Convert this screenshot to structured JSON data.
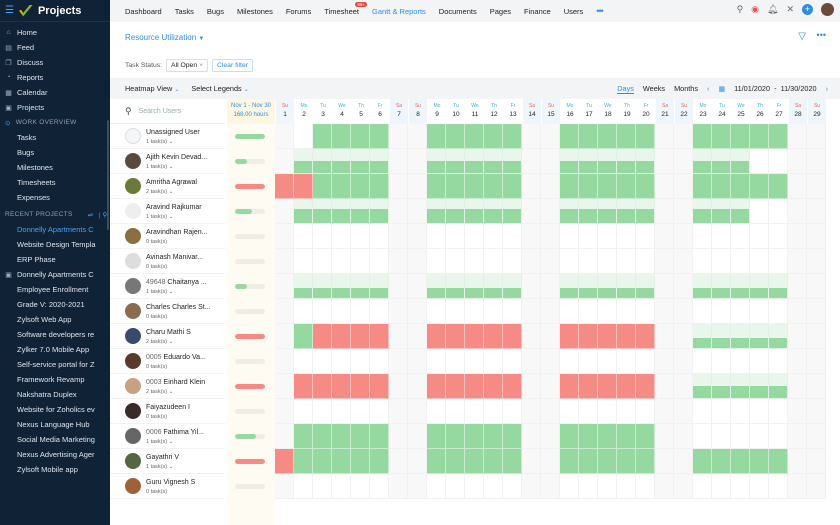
{
  "sidebar": {
    "title": "Projects",
    "items": [
      {
        "label": "Home",
        "icon": "home-icon",
        "glyph": "⌂"
      },
      {
        "label": "Feed",
        "icon": "feed-icon",
        "glyph": "▤"
      },
      {
        "label": "Discuss",
        "icon": "discuss-icon",
        "glyph": "❐"
      },
      {
        "label": "Reports",
        "icon": "reports-icon",
        "glyph": "◔"
      },
      {
        "label": "Calendar",
        "icon": "calendar-icon",
        "glyph": "▦"
      },
      {
        "label": "Projects",
        "icon": "projects-icon",
        "glyph": "▣"
      }
    ],
    "work_overview": {
      "label": "WORK OVERVIEW",
      "items": [
        "Tasks",
        "Bugs",
        "Milestones",
        "Timesheets",
        "Expenses"
      ]
    },
    "recent": {
      "label": "RECENT PROJECTS",
      "items": [
        "Donnelly Apartments C",
        "Website Design Templa",
        "ERP Phase",
        "Donnelly Apartments C",
        "Employee Enrollment",
        "Grade V: 2020-2021",
        "Zylsoft Web App",
        "Software developers re",
        "Zylker 7.0 Mobile App",
        "Self-service portal for Z",
        "Framework Revamp",
        "Nakshatra Duplex",
        "Website for Zoholics ev",
        "Nexus Language Hub",
        "Social Media Marketing",
        "Nexus Advertising Ager",
        "Zylsoft Mobile app"
      ]
    }
  },
  "nav": {
    "items": [
      "Dashboard",
      "Tasks",
      "Bugs",
      "Milestones",
      "Forums",
      "Timesheet",
      "Gantt & Reports",
      "Documents",
      "Pages",
      "Finance",
      "Users"
    ],
    "active": "Gantt & Reports",
    "badge": "99+",
    "more": "•••"
  },
  "header": {
    "report": "Resource Utilization",
    "task_status_label": "Task Status:",
    "task_status_value": "All Open",
    "clear_filter": "Clear filter"
  },
  "toolbar": {
    "view": "Heatmap View",
    "legends": "Select Legends",
    "tabs": [
      "Days",
      "Weeks",
      "Months"
    ],
    "active_tab": "Days",
    "date_range": "11/01/2020  -  11/30/2020"
  },
  "colors": {
    "accent": "#2d8ee6",
    "allocated": "#96d9a0",
    "over": "#f68a85",
    "under_bg": "#e8f6ec"
  },
  "grid": {
    "search_placeholder": "Search Users",
    "period": "Nov 1 - Nov 30",
    "hours": "168.00 hours",
    "days": [
      [
        "Su",
        1
      ],
      [
        "Mo",
        2
      ],
      [
        "Tu",
        3
      ],
      [
        "We",
        4
      ],
      [
        "Th",
        5
      ],
      [
        "Fr",
        6
      ],
      [
        "Sa",
        7
      ],
      [
        "Su",
        8
      ],
      [
        "Mo",
        9
      ],
      [
        "Tu",
        10
      ],
      [
        "We",
        11
      ],
      [
        "Th",
        12
      ],
      [
        "Fr",
        13
      ],
      [
        "Sa",
        14
      ],
      [
        "Su",
        15
      ],
      [
        "Mo",
        16
      ],
      [
        "Tu",
        17
      ],
      [
        "We",
        18
      ],
      [
        "Th",
        19
      ],
      [
        "Fr",
        20
      ],
      [
        "Sa",
        21
      ],
      [
        "Su",
        22
      ],
      [
        "Mo",
        23
      ],
      [
        "Tu",
        24
      ],
      [
        "We",
        25
      ],
      [
        "Th",
        26
      ],
      [
        "Fr",
        27
      ],
      [
        "Sa",
        28
      ],
      [
        "Su",
        29
      ]
    ]
  },
  "users": [
    {
      "id": "",
      "name": "Unassigned User",
      "tasks": "1 task(s)",
      "util": 1,
      "status": "ok",
      "alloc": [
        [
          3,
          6,
          "full"
        ],
        [
          9,
          13,
          "full"
        ],
        [
          16,
          20,
          "full"
        ],
        [
          23,
          27,
          "full"
        ]
      ]
    },
    {
      "id": "",
      "name": "Ajith Kevin Devad...",
      "tasks": "1 task(s)",
      "util": 0.4,
      "status": "ok",
      "alloc": [
        [
          2,
          6,
          0.5
        ],
        [
          9,
          13,
          0.5
        ],
        [
          16,
          20,
          0.5
        ],
        [
          23,
          25,
          0.5
        ]
      ]
    },
    {
      "id": "",
      "name": "Amritha Agrawal",
      "tasks": "2 task(s)",
      "util": 1,
      "status": "over",
      "alloc": [
        [
          1,
          2,
          "over"
        ],
        [
          3,
          6,
          "full"
        ],
        [
          9,
          13,
          "full"
        ],
        [
          16,
          20,
          "full"
        ],
        [
          23,
          27,
          "full"
        ]
      ]
    },
    {
      "id": "",
      "name": "Aravind Rajkumar",
      "tasks": "1 task(s)",
      "util": 0.55,
      "status": "ok",
      "alloc": [
        [
          2,
          6,
          0.6
        ],
        [
          9,
          13,
          0.6
        ],
        [
          16,
          20,
          0.6
        ],
        [
          23,
          25,
          0.6
        ]
      ]
    },
    {
      "id": "",
      "name": "Aravindhan Rajen...",
      "tasks": "0 task(s)",
      "util": 0,
      "status": "ok",
      "alloc": []
    },
    {
      "id": "",
      "name": "Avinash Manivar...",
      "tasks": "0 task(s)",
      "util": 0,
      "status": "ok",
      "alloc": []
    },
    {
      "id": "49648",
      "name": "Chaitanya ...",
      "tasks": "1 task(s)",
      "util": 0.4,
      "status": "ok",
      "alloc": [
        [
          2,
          6,
          0.4
        ],
        [
          9,
          13,
          0.4
        ],
        [
          16,
          20,
          0.4
        ],
        [
          23,
          27,
          0.4
        ]
      ]
    },
    {
      "id": "",
      "name": "Charles Charles St...",
      "tasks": "0 task(s)",
      "util": 0,
      "status": "ok",
      "alloc": []
    },
    {
      "id": "",
      "name": "Charu Mathi S",
      "tasks": "2 task(s)",
      "util": 1,
      "status": "over",
      "alloc": [
        [
          2,
          2,
          "full"
        ],
        [
          3,
          6,
          "over"
        ],
        [
          9,
          13,
          "over"
        ],
        [
          16,
          20,
          "over"
        ],
        [
          23,
          27,
          0.4
        ]
      ]
    },
    {
      "id": "0005",
      "name": "Eduardo Va...",
      "tasks": "0 task(s)",
      "util": 0,
      "status": "ok",
      "alloc": []
    },
    {
      "id": "0003",
      "name": "Einhard Klein",
      "tasks": "2 task(s)",
      "util": 1,
      "status": "over",
      "alloc": [
        [
          2,
          6,
          "over"
        ],
        [
          9,
          13,
          "over"
        ],
        [
          16,
          20,
          "over"
        ],
        [
          23,
          27,
          0.5
        ]
      ]
    },
    {
      "id": "",
      "name": "Faiyazudeen I",
      "tasks": "0 task(s)",
      "util": 0,
      "status": "ok",
      "alloc": []
    },
    {
      "id": "0006",
      "name": "Fathima Yil...",
      "tasks": "1 task(s)",
      "util": 0.7,
      "status": "ok",
      "alloc": [
        [
          2,
          6,
          "full"
        ],
        [
          9,
          13,
          "full"
        ],
        [
          16,
          20,
          "full"
        ]
      ]
    },
    {
      "id": "",
      "name": "Gayathri V",
      "tasks": "1 task(s)",
      "util": 1,
      "status": "over",
      "alloc": [
        [
          1,
          1,
          "over"
        ],
        [
          2,
          6,
          "full"
        ],
        [
          9,
          13,
          "full"
        ],
        [
          16,
          20,
          "full"
        ],
        [
          23,
          27,
          "full"
        ]
      ]
    },
    {
      "id": "",
      "name": "Guru Vignesh S",
      "tasks": "0 task(s)",
      "util": 0,
      "status": "ok",
      "alloc": []
    }
  ]
}
